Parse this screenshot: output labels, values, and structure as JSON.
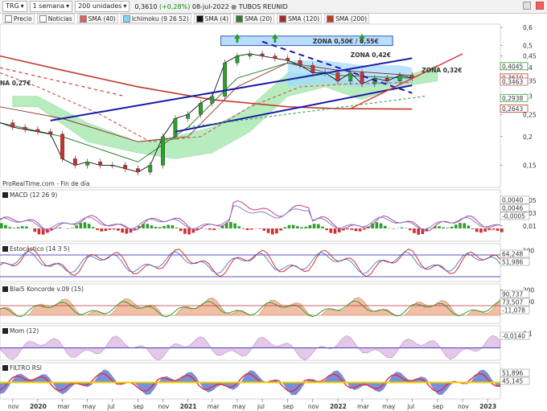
{
  "toolbar": {
    "symbol": "TRG",
    "period": "1 semana",
    "units": "200 unidades",
    "price": "0,3610",
    "change": "(+0,28%)",
    "date": "08-jul-2022",
    "name": "TUBOS REUNID"
  },
  "legend": [
    {
      "label": "Precio",
      "color": "#ffffff"
    },
    {
      "label": "Noticias",
      "color": "#ffffff"
    },
    {
      "label": "SMA (40)",
      "color": "#e06060"
    },
    {
      "label": "Ichimoku (9 26 52)",
      "color": "#7fd4ff"
    },
    {
      "label": "SMA (4)",
      "color": "#111111"
    },
    {
      "label": "SMA (20)",
      "color": "#2e7d2e"
    },
    {
      "label": "SMA (120)",
      "color": "#a52a2a"
    },
    {
      "label": "SMA (200)",
      "color": "#c0392b"
    }
  ],
  "annotations": {
    "zona_050": "ZONA 0,50€ / 0,55€",
    "zona_042": "ZONA 0,42€",
    "zona_032": "ZONA 0,32€",
    "zona_027": "NA 0,27€",
    "source": "ProRealTime.com - Fin de día"
  },
  "price_labels": {
    "last": "0,3610",
    "l1": "0,4045",
    "l2": "0,3463",
    "l3": "0,2938",
    "l4": "0,2643"
  },
  "panels": {
    "macd": {
      "title": "MACD (12 26 9)",
      "labels": [
        "0,0040",
        "0,0046",
        "-0,0005"
      ]
    },
    "stoch": {
      "title": "Estocástico (14 3 5)",
      "labels": [
        "64,248",
        "51,986"
      ]
    },
    "blai5": {
      "title": "Blai5 Koncorde v.09 (15)",
      "labels": [
        "90,737",
        "73,507",
        "-11,078"
      ]
    },
    "mom": {
      "title": "Mom (12)",
      "labels": [
        "-0,0140"
      ]
    },
    "rsi": {
      "title": "FILTRO RSI",
      "labels": [
        "51,896",
        "45,145"
      ]
    }
  },
  "colors": {
    "up": "#2e9e2e",
    "down": "#d23030",
    "trend": "#1a1aa8",
    "ichimoku": "#7ee08a",
    "cloud_blue": "#9fd8ff",
    "zone_box": "#b8ddff"
  },
  "chart_data": [
    {
      "type": "line",
      "title": "TRG",
      "x": [
        "2019-10",
        "2019-11",
        "2019-12",
        "2020-01",
        "2020-02",
        "2020-03",
        "2020-04",
        "2020-05",
        "2020-06",
        "2020-07",
        "2020-08",
        "2020-09",
        "2020-10",
        "2020-11",
        "2020-12",
        "2021-01",
        "2021-02",
        "2021-03",
        "2021-04",
        "2021-05",
        "2021-06",
        "2021-07",
        "2021-08",
        "2021-09",
        "2021-10",
        "2021-11",
        "2021-12",
        "2022-01",
        "2022-02",
        "2022-03",
        "2022-04",
        "2022-05",
        "2022-06",
        "2022-07"
      ],
      "series": [
        {
          "name": "Precio",
          "values": [
            0.23,
            0.22,
            0.215,
            0.21,
            0.205,
            0.16,
            0.15,
            0.155,
            0.15,
            0.15,
            0.145,
            0.14,
            0.15,
            0.2,
            0.24,
            0.25,
            0.28,
            0.3,
            0.42,
            0.45,
            0.46,
            0.45,
            0.44,
            0.43,
            0.41,
            0.38,
            0.38,
            0.35,
            0.38,
            0.34,
            0.36,
            0.35,
            0.37,
            0.361
          ]
        }
      ],
      "x_ticks": [
        "nov",
        "2020",
        "mar",
        "may",
        "jul",
        "sep",
        "nov",
        "2021",
        "mar",
        "may",
        "jul",
        "sep",
        "nov",
        "2022",
        "mar",
        "may",
        "jul",
        "sep",
        "nov",
        "2023"
      ],
      "y_ticks": [
        "0,6",
        "0,5",
        "0,45",
        "0,4",
        "0,35",
        "0,3",
        "0,25",
        "0,2",
        "0,15"
      ],
      "ylim": [
        0.12,
        0.62
      ],
      "scale": "log",
      "grid": false
    },
    {
      "type": "bar",
      "title": "MACD (12 26 9)",
      "y_ticks": [
        "0,05",
        "0,03",
        "0,01"
      ]
    },
    {
      "type": "line",
      "title": "Estocástico (14 3 5)",
      "y_ticks": [
        "100"
      ]
    },
    {
      "type": "area",
      "title": "Blai5 Koncorde v.09 (15)",
      "y_ticks": [
        "200",
        "100"
      ]
    },
    {
      "type": "area",
      "title": "Mom (12)",
      "y_ticks": [
        "0,1"
      ]
    },
    {
      "type": "area",
      "title": "FILTRO RSI",
      "y_ticks": []
    }
  ]
}
